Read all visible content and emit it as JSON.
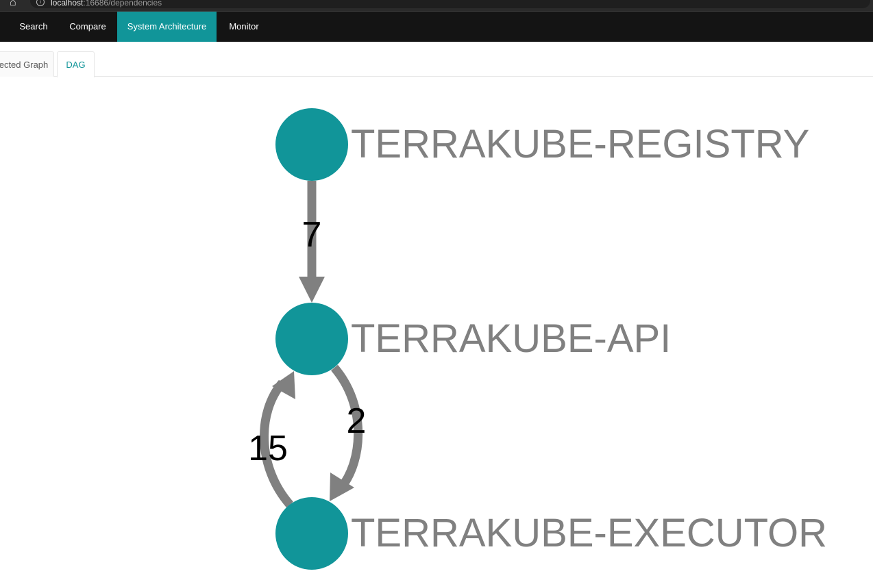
{
  "browser": {
    "url_host": "localhost",
    "url_rest": ":16686/dependencies"
  },
  "nav": {
    "items": [
      {
        "label": "Search"
      },
      {
        "label": "Compare"
      },
      {
        "label": "System Architecture",
        "active": true
      },
      {
        "label": "Monitor"
      }
    ]
  },
  "tabs": {
    "items": [
      {
        "label": "Force Directed Graph",
        "visible_text": "ected Graph"
      },
      {
        "label": "DAG",
        "active": true
      }
    ]
  },
  "colors": {
    "accent": "#119599",
    "node": "#119599",
    "edge": "#808080",
    "node_label": "#808080",
    "nav_bg": "#141414"
  },
  "dag": {
    "nodes": [
      {
        "id": "registry",
        "label": "TERRAKUBE-REGISTRY"
      },
      {
        "id": "api",
        "label": "TERRAKUBE-API"
      },
      {
        "id": "executor",
        "label": "TERRAKUBE-EXECUTOR"
      }
    ],
    "edges": [
      {
        "from": "registry",
        "to": "api",
        "calls": 7
      },
      {
        "from": "api",
        "to": "executor",
        "calls": 2
      },
      {
        "from": "executor",
        "to": "api",
        "calls": 15
      }
    ]
  }
}
